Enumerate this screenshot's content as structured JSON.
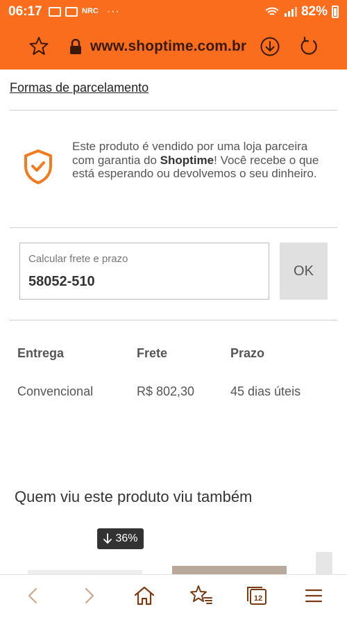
{
  "status_bar": {
    "time": "06:17",
    "nrc": "NRC",
    "dots": "···",
    "battery": "82%"
  },
  "browser": {
    "url": "www.shoptime.com.br"
  },
  "content": {
    "installments_link": "Formas de parcelamento",
    "guarantee": {
      "line1": "Este produto é vendido por uma loja parceira com garantia do ",
      "brand": "Shoptime",
      "line2": "! Você recebe o que está esperando ou devolvemos o seu dinheiro."
    },
    "shipping": {
      "label": "Calcular frete e prazo",
      "value": "58052-510",
      "ok_label": "OK"
    },
    "table": {
      "headers": [
        "Entrega",
        "Frete",
        "Prazo"
      ],
      "rows": [
        [
          "Convencional",
          "R$ 802,30",
          "45 dias úteis"
        ]
      ]
    },
    "related_title": "Quem viu este produto viu também",
    "discount_badge": "36%"
  },
  "colors": {
    "brand_orange": "#fa6d1d",
    "shield_orange": "#f47a20"
  }
}
